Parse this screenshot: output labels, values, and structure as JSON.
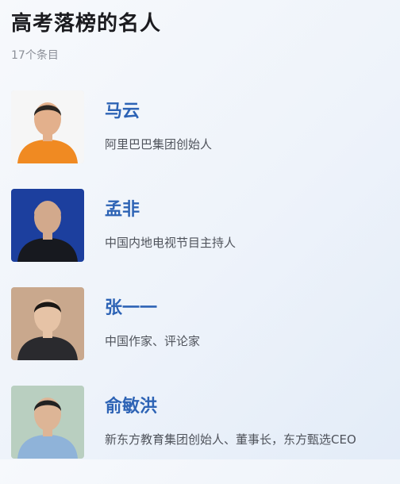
{
  "header": {
    "title": "高考落榜的名人",
    "count": "17个条目"
  },
  "people": [
    {
      "name": "马云",
      "description": "阿里巴巴集团创始人",
      "colors": {
        "bg": "#f6f6f6",
        "shirt": "#f08a22",
        "skin": "#e3b08c",
        "hair": "#2b2622"
      }
    },
    {
      "name": "孟非",
      "description": "中国内地电视节目主持人",
      "colors": {
        "bg": "#1c3f9e",
        "shirt": "#17191f",
        "skin": "#d2a98c",
        "hair": "#d2a98c"
      }
    },
    {
      "name": "张一一",
      "description": "中国作家、评论家",
      "colors": {
        "bg": "#c9a88d",
        "shirt": "#2a2a2e",
        "skin": "#e6c3a6",
        "hair": "#1a1714"
      }
    },
    {
      "name": "俞敏洪",
      "description": "新东方教育集团创始人、董事长，东方甄选CEO",
      "colors": {
        "bg": "#b9cfc0",
        "shirt": "#8fb3d9",
        "skin": "#ddb596",
        "hair": "#222"
      }
    }
  ]
}
